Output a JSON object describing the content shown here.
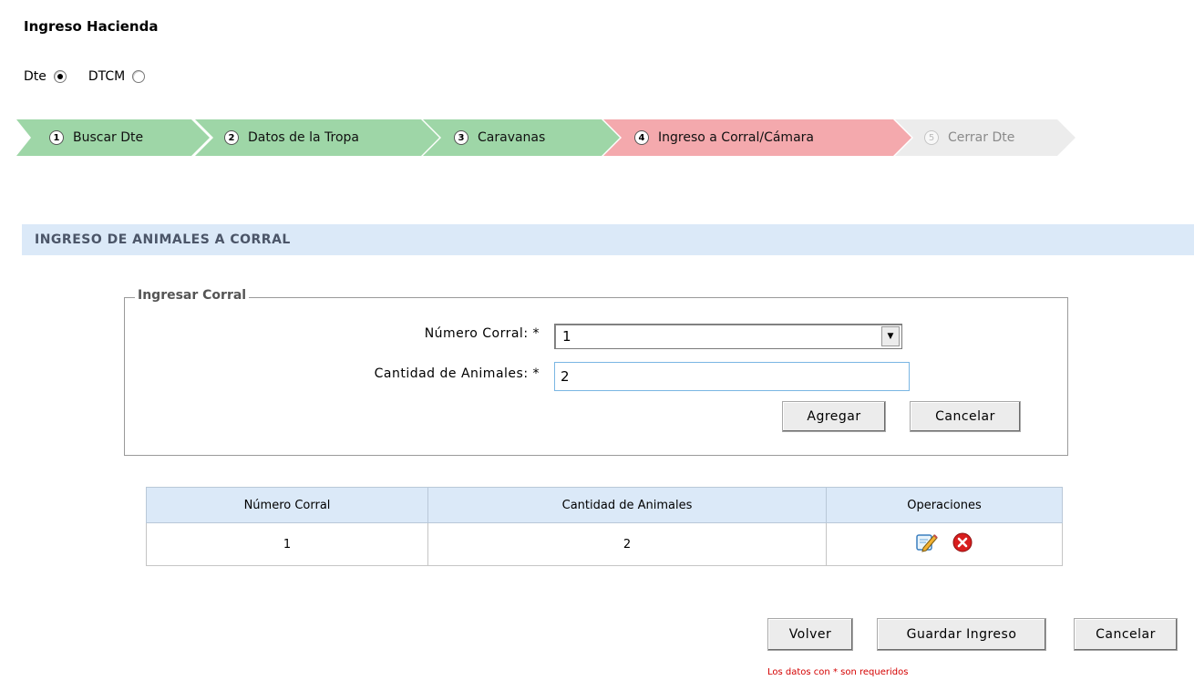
{
  "page": {
    "title": "Ingreso Hacienda"
  },
  "doc_type": {
    "options": [
      {
        "label": "Dte",
        "checked": true
      },
      {
        "label": "DTCM",
        "checked": false
      }
    ]
  },
  "wizard": {
    "steps": [
      {
        "num": "1",
        "label": "Buscar Dte",
        "state": "done"
      },
      {
        "num": "2",
        "label": "Datos de la Tropa",
        "state": "done"
      },
      {
        "num": "3",
        "label": "Caravanas",
        "state": "done"
      },
      {
        "num": "4",
        "label": "Ingreso a Corral/Cámara",
        "state": "active"
      },
      {
        "num": "5",
        "label": "Cerrar Dte",
        "state": "pending"
      }
    ]
  },
  "section": {
    "title": "INGRESO DE ANIMALES A CORRAL"
  },
  "form": {
    "legend": "Ingresar Corral",
    "corral_label": "Número Corral: *",
    "corral_value": "1",
    "cantidad_label": "Cantidad de Animales: *",
    "cantidad_value": "2",
    "add_label": "Agregar",
    "cancel_label": "Cancelar"
  },
  "table": {
    "headers": [
      "Número Corral",
      "Cantidad de Animales",
      "Operaciones"
    ],
    "rows": [
      {
        "corral": "1",
        "cantidad": "2"
      }
    ]
  },
  "actions": {
    "back_label": "Volver",
    "save_label": "Guardar Ingreso",
    "cancel_label": "Cancelar"
  },
  "note": "Los datos con * son requeridos",
  "colors": {
    "step_done": "#9ed6a7",
    "step_active": "#f4a9ad",
    "step_pending": "#ececec",
    "header_bg": "#dbe9f8",
    "note": "#d40000"
  },
  "icons": [
    "edit-icon",
    "delete-icon",
    "dropdown-arrow-icon"
  ]
}
